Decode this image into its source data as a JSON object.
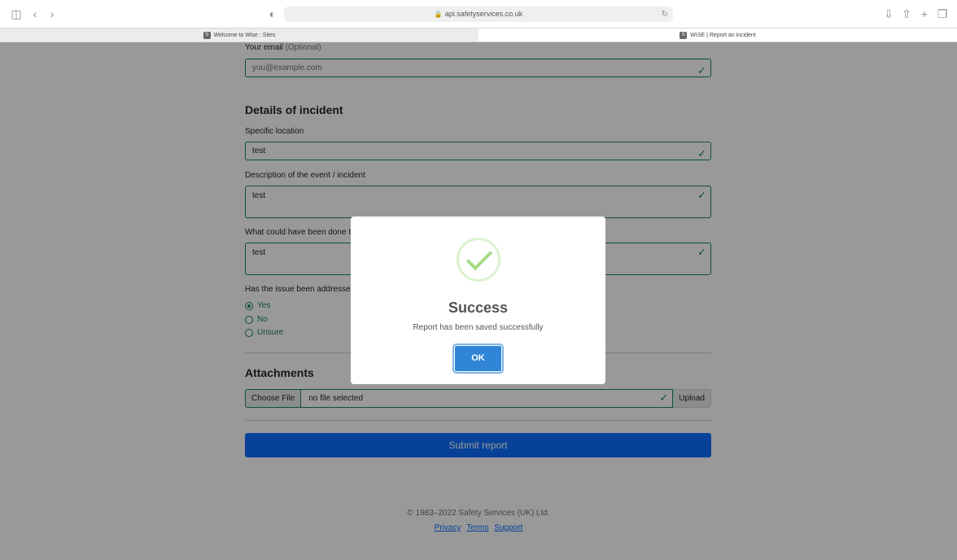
{
  "browser": {
    "url": "api.safetyservices.co.uk",
    "tabs": [
      {
        "label": "Welcome to Wise : Sites",
        "favicon": "S"
      },
      {
        "label": "WISE | Report an incident",
        "favicon": "S"
      }
    ]
  },
  "form": {
    "email_label": "Your email",
    "email_optional": "(Optional)",
    "email_placeholder": "you@example.com",
    "details_heading": "Details of incident",
    "location_label": "Specific location",
    "location_value": "test",
    "description_label": "Description of the event / incident",
    "description_value": "test",
    "prevent_label": "What could have been done t",
    "prevent_value": "test",
    "addressed_label": "Has the issue been addressed",
    "addressed_options": [
      {
        "label": "Yes",
        "selected": true
      },
      {
        "label": "No",
        "selected": false
      },
      {
        "label": "Unsure",
        "selected": false
      }
    ],
    "attachments_heading": "Attachments",
    "choose_file_label": "Choose File",
    "file_status": "no file selected",
    "upload_label": "Upload",
    "submit_label": "Submit report"
  },
  "footer": {
    "copyright": "© 1983–2022 Safety Services (UK) Ltd.",
    "links": [
      "Privacy",
      "Terms",
      "Support"
    ]
  },
  "modal": {
    "title": "Success",
    "message": "Report has been saved successfully",
    "ok_label": "OK"
  },
  "colors": {
    "valid": "#198754",
    "primary": "#0d6efd",
    "success_icon": "#a5dc86",
    "ok_button": "#3085d6"
  }
}
